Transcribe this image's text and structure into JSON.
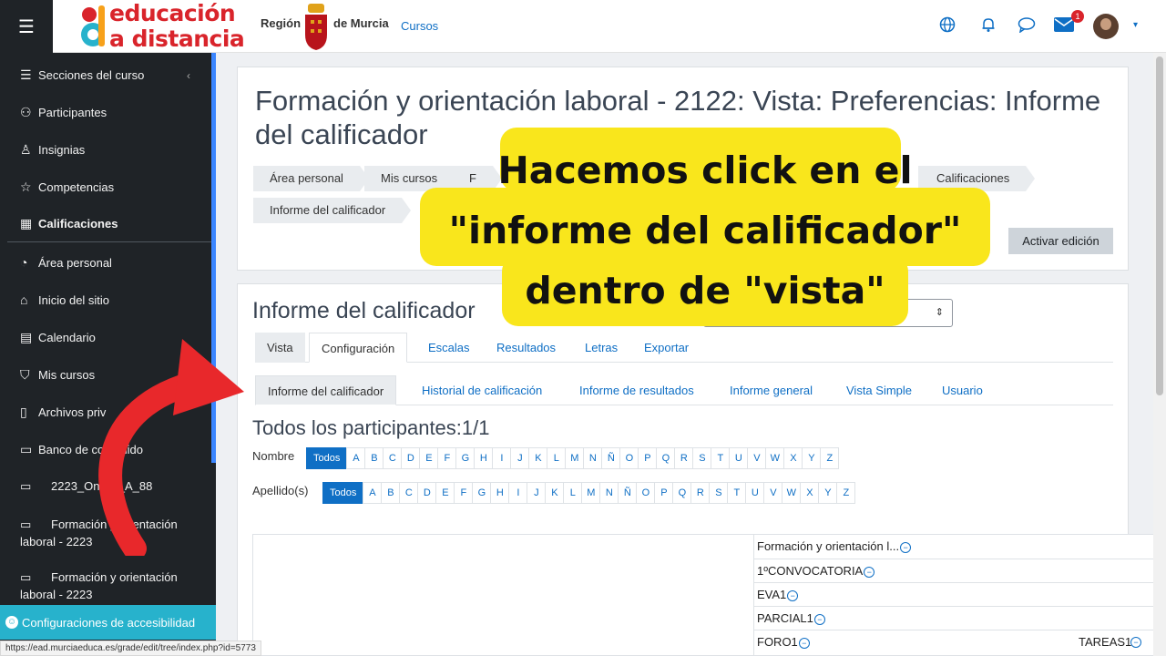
{
  "topbar": {
    "logo_line1": "educación",
    "logo_line2": "a distancia",
    "region_left": "Región",
    "region_right": "de Murcia",
    "cursos_link": "Cursos",
    "message_badge": "1"
  },
  "sidebar": {
    "items": [
      {
        "label": "Secciones del curso",
        "icon": "list-icon"
      },
      {
        "label": "Participantes",
        "icon": "users-icon"
      },
      {
        "label": "Insignias",
        "icon": "badge-icon"
      },
      {
        "label": "Competencias",
        "icon": "star-icon"
      },
      {
        "label": "Calificaciones",
        "icon": "gradebook-icon"
      },
      {
        "label": "Área personal",
        "icon": "dashboard-icon"
      },
      {
        "label": "Inicio del sitio",
        "icon": "home-icon"
      },
      {
        "label": "Calendario",
        "icon": "calendar-icon"
      },
      {
        "label": "Mis cursos",
        "icon": "graduation-cap-icon"
      },
      {
        "label": "Archivos priv",
        "icon": "file-icon"
      },
      {
        "label": "Banco de contenido",
        "icon": "clipboard-icon"
      }
    ],
    "folders": [
      {
        "label": "2223_Online_A_88"
      },
      {
        "label_line1": "Formación y orientación",
        "label_line2": "laboral - 2223"
      },
      {
        "label_line1": "Formación y orientación",
        "label_line2": "laboral - 2223"
      }
    ],
    "accessibility": "Configuraciones de accesibilidad"
  },
  "header": {
    "title": "Formación y orientación laboral - 2122: Vista: Preferencias: Informe del calificador",
    "breadcrumb": [
      "Área personal",
      "Mis cursos",
      "F",
      "Calificaciones",
      "Informe del calificador"
    ],
    "edit_button": "Activar edición"
  },
  "main": {
    "section_title": "Informe del calificador",
    "tabs_primary": [
      "Vista",
      "Configuración",
      "Escalas",
      "Resultados",
      "Letras",
      "Exportar"
    ],
    "tabs_secondary": [
      "Informe del calificador",
      "Historial de calificación",
      "Informe de resultados",
      "Informe general",
      "Vista Simple",
      "Usuario"
    ],
    "participants_heading": "Todos los participantes:1/1",
    "filter_first_label": "Nombre",
    "filter_last_label": "Apellido(s)",
    "filter_all": "Todos",
    "letters": [
      "A",
      "B",
      "C",
      "D",
      "E",
      "F",
      "G",
      "H",
      "I",
      "J",
      "K",
      "L",
      "M",
      "N",
      "Ñ",
      "O",
      "P",
      "Q",
      "R",
      "S",
      "T",
      "U",
      "V",
      "W",
      "X",
      "Y",
      "Z"
    ],
    "grade_rows": [
      "Formación y orientación l...",
      "1ºCONVOCATORIA",
      "EVA1",
      "PARCIAL1",
      "FORO1"
    ],
    "grade_extra": "TAREAS1"
  },
  "statusbar": "https://ead.murciaeduca.es/grade/edit/tree/index.php?id=5773",
  "overlay": {
    "callout_line1": "Hacemos click en el",
    "callout_line2": "\"informe del calificador\"",
    "callout_line3": "dentro de \"vista\"",
    "highlight_color": "#f9e61c",
    "arrow_color": "#e8282b"
  }
}
